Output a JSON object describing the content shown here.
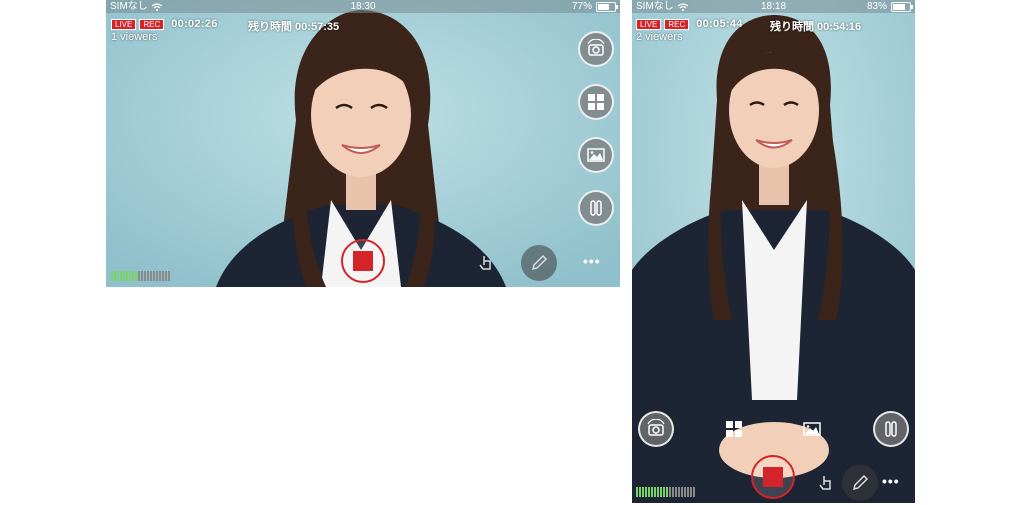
{
  "screens": [
    {
      "status": {
        "carrier": "SIMなし",
        "time": "18:30",
        "battery": "77%"
      },
      "badges": {
        "live": "LIVE",
        "rec": "REC"
      },
      "timer": "00:02:26",
      "viewers": "1 viewers",
      "remaining": "残り時間 00:57:35",
      "battery_level": 0.77,
      "audio_meter_level": 0.45
    },
    {
      "status": {
        "carrier": "SIMなし",
        "time": "18:18",
        "battery": "83%"
      },
      "badges": {
        "live": "LIVE",
        "rec": "REC"
      },
      "timer": "00:05:44",
      "viewers": "2 viewers",
      "remaining": "残り時間 00:54:16",
      "battery_level": 0.83,
      "audio_meter_level": 0.55
    }
  ],
  "icons": {
    "camera_switch": "camera-switch-icon",
    "layout": "grid-layout-icon",
    "image": "image-icon",
    "pause": "pause-icon",
    "stop": "stop-icon",
    "touch": "hand-touch-icon",
    "pen": "pen-icon",
    "more": "more-icon"
  },
  "colors": {
    "record": "#d4242a",
    "meter_on": "#7ad36a",
    "meter_off": "#8a8a8a"
  }
}
